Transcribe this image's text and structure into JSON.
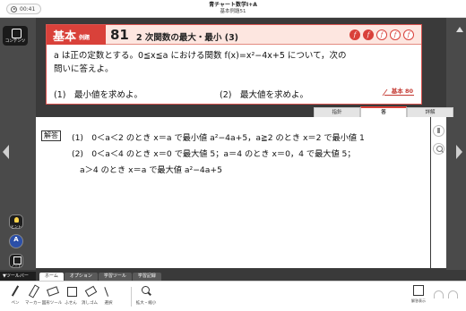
{
  "header": {
    "timer": "00:41",
    "book_title": "青チャート数学Ⅰ+A",
    "page_subtitle": "基本例題51"
  },
  "sidebar": {
    "content_label": "コンテンツ"
  },
  "problem": {
    "category": "基本",
    "category_suffix": "例題",
    "number": "81",
    "title": "2 次関数の最大・最小 (3)",
    "difficulty": [
      "f",
      "f",
      "f",
      "f",
      "f"
    ],
    "difficulty_filled": 2,
    "text_line1": "a は正の定数とする。0≦x≦a における関数 f(x)=x²−4x+5 について，次の",
    "text_line2": "問いに答えよ。",
    "q1": "(1)　最小値を求めよ。",
    "q2": "(2)　最大値を求めよ。",
    "reference": "基本 80"
  },
  "tabs": [
    {
      "label": "指針",
      "active": false
    },
    {
      "label": "答",
      "active": true
    },
    {
      "label": "詳解",
      "active": false
    }
  ],
  "answer": {
    "label": "解答",
    "line1": "(1)　0＜a＜2 のとき x＝a で最小値 a²−4a+5，a≧2 のとき x＝2 で最小値 1",
    "line2": "(2)　0＜a＜4 のとき x＝0 で最大値 5；a＝4 のとき x＝0，4 で最大値 5；",
    "line3": "a＞4 のとき x＝a で最大値 a²−4a+5"
  },
  "float_buttons": {
    "hint": "ヒント",
    "answer": "解答",
    "note": "ノート"
  },
  "toolbar": {
    "toggle": "▼ツールバー",
    "tabs": [
      {
        "label": "ホーム",
        "active": true
      },
      {
        "label": "オプション",
        "active": false
      },
      {
        "label": "学習ツール",
        "active": false
      },
      {
        "label": "学習記録",
        "active": false
      }
    ],
    "tools": {
      "pen": "ペン",
      "marker": "マーカー",
      "ruler": "図形ツール",
      "fusen": "ふせん",
      "eraser": "消しゴム",
      "select": "選択",
      "zoom": "拡大・縮小"
    },
    "answer_display": "解答表示"
  },
  "colors": {
    "accent": "#d9413a",
    "tag_bg": "#fde6e0"
  }
}
